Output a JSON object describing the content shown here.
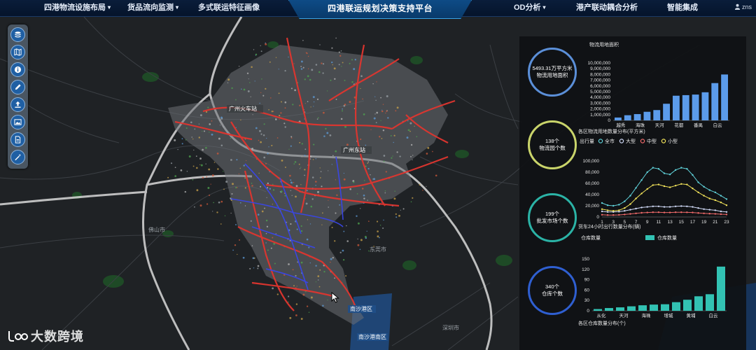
{
  "nav": {
    "items": [
      {
        "label": "四港物流设施布局",
        "dropdown": true
      },
      {
        "label": "货品流向监测",
        "dropdown": true
      },
      {
        "label": "多式联运特征画像",
        "dropdown": false
      },
      {
        "label": "OD分析",
        "dropdown": true
      },
      {
        "label": "港产联动耦合分析",
        "dropdown": false
      },
      {
        "label": "智能集成",
        "dropdown": false
      }
    ],
    "title": "四港联运规划决策支持平台",
    "user": "zns",
    "caret": "▾"
  },
  "toolbar": {
    "tools": [
      "layers-icon",
      "map-icon",
      "info-icon",
      "pencil-icon",
      "upload-icon",
      "image-icon",
      "document-icon",
      "magic-wand-icon"
    ]
  },
  "map_labels": [
    {
      "text": "广州火车站",
      "name": "map-label-1"
    },
    {
      "text": "广州东站",
      "name": "map-label-2"
    },
    {
      "text": "东莞市",
      "name": "map-label-3"
    },
    {
      "text": "佛山市",
      "name": "map-label-4"
    },
    {
      "text": "深圳市",
      "name": "map-label-5"
    },
    {
      "text": "南沙港区",
      "name": "map-label-6"
    },
    {
      "text": "南沙港南区",
      "name": "map-label-7"
    }
  ],
  "kpis": [
    {
      "value": "5493.31万平方米",
      "label": "物流用地面积",
      "color": "#5b8fd8"
    },
    {
      "value": "138个",
      "label": "物流园个数",
      "color": "#c9d46a"
    },
    {
      "value": "199个",
      "label": "批发市场个数",
      "color": "#2bb3a6"
    },
    {
      "value": "340个",
      "label": "仓库个数",
      "color": "#2f5fd1"
    }
  ],
  "watermark": "大数跨境",
  "chart_data": [
    {
      "type": "bar",
      "title": "物流用地面积",
      "caption": "各区物流用地数量分布(平方米)",
      "categories": [
        "越秀",
        "海珠",
        "天河",
        "花都",
        "番禺",
        "白云"
      ],
      "values": [
        500000,
        900000,
        1100000,
        1500000,
        1800000,
        2900000,
        4300000,
        4400000,
        4500000,
        4900000,
        6500000,
        8000000
      ],
      "ylim": [
        0,
        10000000
      ],
      "yticks": [
        "0",
        "1,000,000",
        "2,000,000",
        "3,000,000",
        "4,000,000",
        "5,000,000",
        "6,000,000",
        "7,000,000",
        "8,000,000",
        "9,000,000",
        "10,000,000"
      ],
      "color": "#5b9bea"
    },
    {
      "type": "line",
      "legend_title": "出行量",
      "caption": "货车24小时出行数量分布(辆)",
      "x": [
        1,
        2,
        3,
        4,
        5,
        6,
        7,
        8,
        9,
        10,
        11,
        12,
        13,
        14,
        15,
        16,
        17,
        18,
        19,
        20,
        21,
        22,
        23
      ],
      "xticks": [
        "1",
        "3",
        "5",
        "7",
        "9",
        "11",
        "13",
        "15",
        "17",
        "19",
        "21",
        "23"
      ],
      "ylim": [
        0,
        100000
      ],
      "yticks": [
        "0",
        "20,000",
        "40,000",
        "60,000",
        "80,000",
        "100,000"
      ],
      "series": [
        {
          "name": "全市",
          "color": "#5fd0d8",
          "values": [
            25000,
            21000,
            20000,
            22000,
            28000,
            38000,
            52000,
            66000,
            80000,
            88000,
            86000,
            78000,
            76000,
            84000,
            88000,
            86000,
            75000,
            62000,
            54000,
            48000,
            44000,
            38000,
            32000
          ]
        },
        {
          "name": "大型",
          "color": "#cfd8f5",
          "values": [
            10000,
            9000,
            9000,
            9500,
            11000,
            13000,
            15000,
            17000,
            18000,
            19000,
            19000,
            18000,
            18000,
            19000,
            19500,
            19000,
            18000,
            16000,
            14000,
            13000,
            12000,
            10000,
            9000
          ]
        },
        {
          "name": "中型",
          "color": "#f06a6a",
          "values": [
            4000,
            3500,
            3500,
            3800,
            4500,
            5500,
            6500,
            7500,
            8000,
            8500,
            8500,
            8000,
            8000,
            8500,
            8500,
            8300,
            8000,
            7200,
            6500,
            6000,
            5600,
            5000,
            4500
          ]
        },
        {
          "name": "小型",
          "color": "#f2e35a",
          "values": [
            14000,
            12000,
            11000,
            12000,
            16000,
            23000,
            33000,
            42000,
            50000,
            57000,
            58000,
            55000,
            53000,
            56000,
            59000,
            58000,
            51000,
            44000,
            38000,
            33000,
            30000,
            26000,
            21000
          ]
        }
      ]
    },
    {
      "type": "bar",
      "title": "仓库数量",
      "legend": "仓库数量",
      "caption": "各区仓库数量分布(个)",
      "categories": [
        "从化",
        "天河",
        "海珠",
        "增城",
        "黄埔",
        "白云"
      ],
      "values": [
        5,
        8,
        10,
        13,
        16,
        18,
        19,
        25,
        32,
        42,
        48,
        128
      ],
      "ylim": [
        0,
        150
      ],
      "yticks": [
        "0",
        "30",
        "60",
        "90",
        "120",
        "150"
      ],
      "color": "#32c2b3"
    }
  ]
}
